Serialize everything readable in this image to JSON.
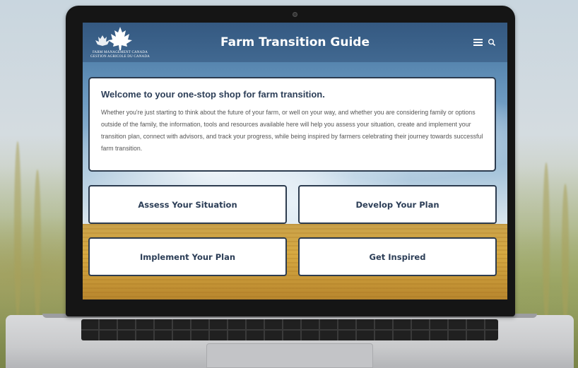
{
  "header": {
    "title": "Farm Transition Guide",
    "logo_line1": "FARM MANAGEMENT CANADA",
    "logo_line2": "GESTION AGRICOLE DU CANADA",
    "menu_icon": "hamburger-menu-icon",
    "search_icon": "search-icon"
  },
  "welcome": {
    "title": "Welcome to your one-stop shop for farm transition.",
    "body": "Whether you're just starting to think about the future of your farm, or well on your way, and whether you are considering family or options outside of the family, the information, tools and resources available here will help you assess your situation, create and implement your transition plan, connect with advisors, and track your progress, while being inspired by farmers celebrating their journey towards successful farm transition."
  },
  "nav_cards": [
    {
      "label": "Assess Your Situation"
    },
    {
      "label": "Develop Your Plan"
    },
    {
      "label": "Implement Your Plan"
    },
    {
      "label": "Get Inspired"
    }
  ]
}
